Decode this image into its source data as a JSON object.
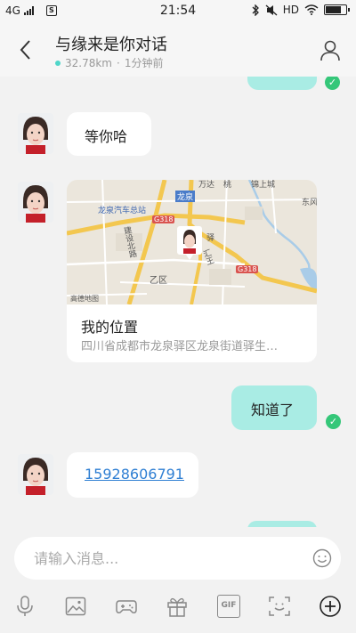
{
  "status_bar": {
    "network": "4G",
    "time": "21:54",
    "hd": "HD"
  },
  "header": {
    "title": "与缘来是你对话",
    "distance": "32.78km",
    "separator": "·",
    "last_seen": "1分钟前"
  },
  "messages": {
    "incoming_1": "等你哈",
    "location": {
      "title": "我的位置",
      "address": "四川省成都市龙泉驿区龙泉街道驿生…",
      "map_labels": {
        "longquan": "龙泉",
        "bus_station": "龙泉汽车总站",
        "road_g318_a": "G318",
        "road_g318_b": "G318",
        "yi_district": "乙区",
        "yi": "驿",
        "dongfeng": "东风",
        "jianshe_north": "建设北路",
        "huiwang": "汇王",
        "gaode": "高德地图",
        "top_left": "万达",
        "top_mid": "桃",
        "top_right": "锦上城"
      }
    },
    "outgoing_1": "知道了",
    "incoming_phone": "15928606791"
  },
  "input": {
    "placeholder": "请输入消息..."
  },
  "toolbar": {
    "gif_label": "GIF"
  },
  "colors": {
    "outgoing_bubble": "#a9ece4",
    "read_tick": "#35c779",
    "link": "#2f7fd3",
    "online_dot": "#4fd6c9"
  }
}
